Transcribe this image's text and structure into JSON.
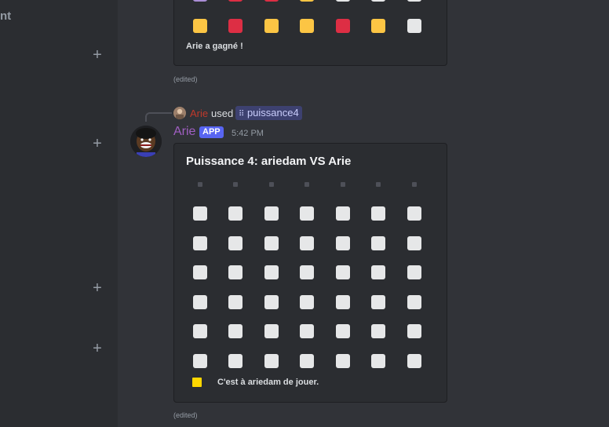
{
  "sidebar": {
    "partial_label": "nt",
    "add_icon": "plus-icon"
  },
  "previous_message": {
    "status_text": "Arie a gagné !",
    "edited_label": "(edited)",
    "board_top_partial": [
      "purple",
      "red",
      "red",
      "yellow",
      "white",
      "white",
      "white"
    ],
    "board_bottom_row": [
      "yellow",
      "red",
      "yellow",
      "yellow",
      "red",
      "yellow",
      "white"
    ]
  },
  "reply": {
    "user": "Arie",
    "used_text": "used",
    "command": "puissance4",
    "command_icon": "slash-command-icon"
  },
  "message": {
    "author": "Arie",
    "badge": "APP",
    "timestamp": "5:42 PM",
    "embed": {
      "title": "Puissance 4: ariedam VS Arie",
      "turn_text": "C'est à ariedam de jouer.",
      "turn_color": "#ffd700",
      "columns": 7,
      "rows": 6,
      "cell_state": "empty"
    },
    "edited_label": "(edited)"
  },
  "colors": {
    "yellow": "#fcc544",
    "red": "#dd2e44",
    "white": "#e6e7e8",
    "purple": "#aa8ed6",
    "app_badge": "#5865f2",
    "author": "#a05fc2"
  }
}
